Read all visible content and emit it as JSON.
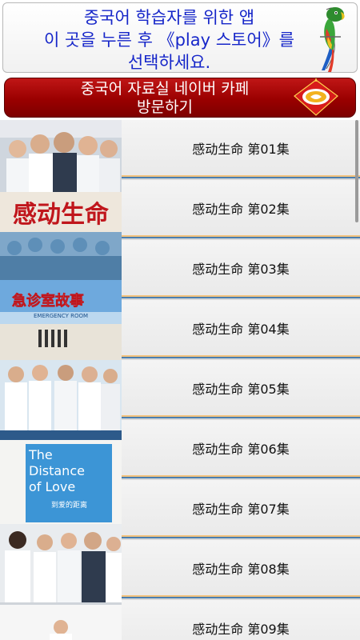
{
  "banner": {
    "line1": "중국어 학습자를 위한 앱",
    "line2": "이 곳을 누른 후 《play 스토어》를",
    "line3": "선택하세요."
  },
  "cafe": {
    "line1": "중국어 자료실 네이버 카페",
    "line2": "방문하기"
  },
  "poster": {
    "title_cn_1": "感动生命",
    "title_cn_2": "急诊室故事",
    "subtitle_en": "EMERGENCY ROOM",
    "title_en_1": "The",
    "title_en_2": "Distance",
    "title_en_3": "of Love",
    "title_cn_3": "到爱的距离"
  },
  "episodes": [
    "感动生命 第01集",
    "感动生命 第02集",
    "感动生命 第03集",
    "感动生命 第04集",
    "感动生命 第05集",
    "感动生命 第06集",
    "感动生命 第07集",
    "感动生命 第08集",
    "感动生命 第09集"
  ],
  "colors": {
    "banner_text": "#1626c9",
    "cafe_bg": "#9a0000",
    "separator_orange": "#f2c27e",
    "separator_blue": "#4a7fb0"
  }
}
